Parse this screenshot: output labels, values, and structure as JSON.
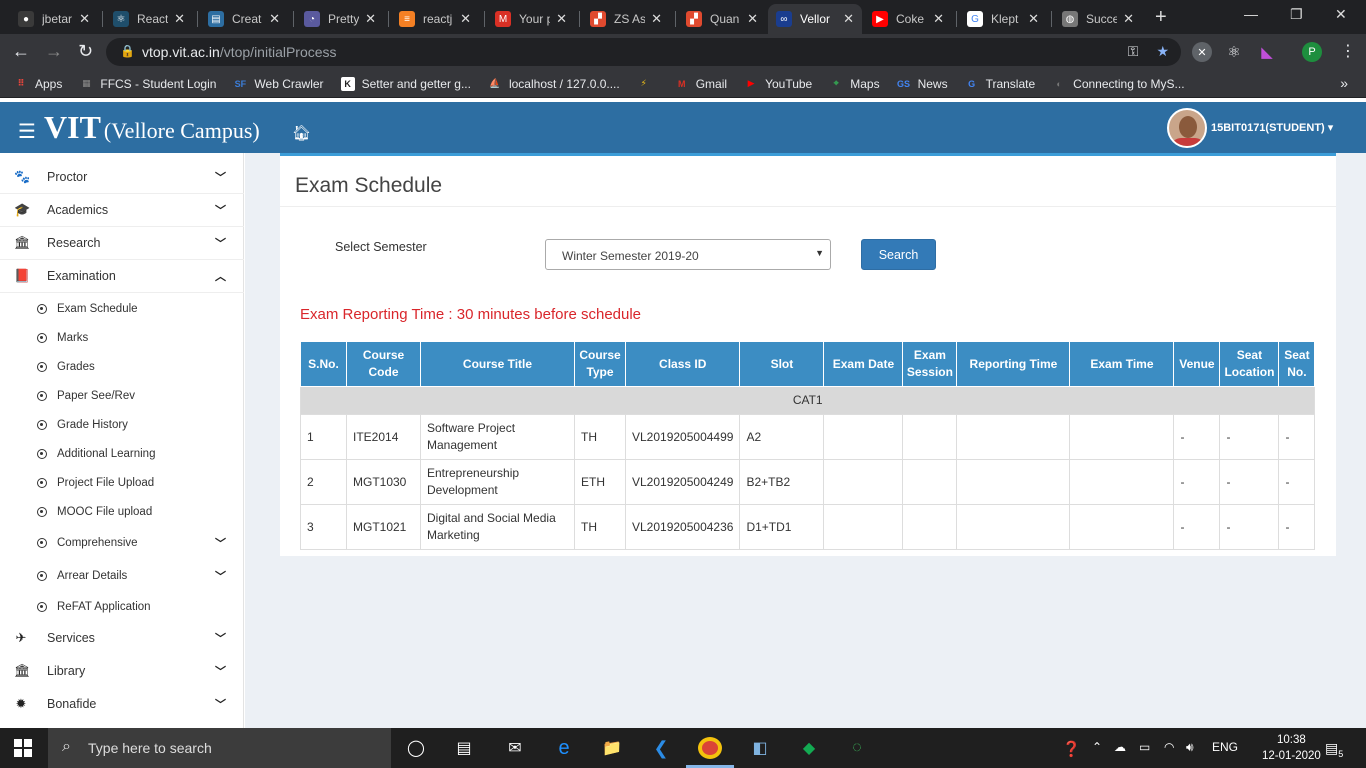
{
  "browser": {
    "tabs": [
      {
        "title": "jbetar",
        "fav_color": "#3a3a3a",
        "fav_glyph": "●"
      },
      {
        "title": "React",
        "fav_color": "#1f4e6b",
        "fav_glyph": "⚛"
      },
      {
        "title": "Creat",
        "fav_color": "#2d6ea2",
        "fav_glyph": "▤"
      },
      {
        "title": "Pretty",
        "fav_color": "#5a5a9e",
        "fav_glyph": "◔"
      },
      {
        "title": "reactj",
        "fav_color": "#f48024",
        "fav_glyph": "≡"
      },
      {
        "title": "Your p",
        "fav_color": "#d93025",
        "fav_glyph": "M"
      },
      {
        "title": "ZS As",
        "fav_color": "#e04a2f",
        "fav_glyph": "▞"
      },
      {
        "title": "Quan",
        "fav_color": "#e04a2f",
        "fav_glyph": "▞"
      },
      {
        "title": "Vellor",
        "fav_color": "#1a3d8f",
        "fav_glyph": "∞"
      },
      {
        "title": "Coke",
        "fav_color": "#ff0000",
        "fav_glyph": "▶"
      },
      {
        "title": "Klept",
        "fav_color": "#ffffff",
        "fav_glyph": "G"
      },
      {
        "title": "Succe",
        "fav_color": "#777777",
        "fav_glyph": "◍"
      }
    ],
    "active_tab_index": 8,
    "url_host": "vtop.vit.ac.in",
    "url_path": "/vtop/initialProcess",
    "profile_initial": "P",
    "bookmarks": [
      {
        "label": "Apps",
        "icon_color": "#e8453c",
        "glyph": "⠿"
      },
      {
        "label": "FFCS - Student Login",
        "icon_color": "#8a8a8a",
        "glyph": "▦"
      },
      {
        "label": "Web Crawler",
        "icon_color": "#3b7dd8",
        "glyph": "SF"
      },
      {
        "label": "Setter and getter g...",
        "icon_color": "#ffffff",
        "glyph": "K"
      },
      {
        "label": "localhost / 127.0.0....",
        "icon_color": "#f0a030",
        "glyph": "⛵"
      },
      {
        "label": "",
        "icon_color": "#f5c518",
        "glyph": "⚡"
      },
      {
        "label": "Gmail",
        "icon_color": "#d93025",
        "glyph": "M"
      },
      {
        "label": "YouTube",
        "icon_color": "#ff0000",
        "glyph": "▶"
      },
      {
        "label": "Maps",
        "icon_color": "#34a853",
        "glyph": "⌖"
      },
      {
        "label": "News",
        "icon_color": "#4285f4",
        "glyph": "GS"
      },
      {
        "label": "Translate",
        "icon_color": "#4285f4",
        "glyph": "G"
      },
      {
        "label": "Connecting to MyS...",
        "icon_color": "#777777",
        "glyph": "◐"
      }
    ]
  },
  "header": {
    "brand": "VIT",
    "campus": "(Vellore Campus)",
    "user_id": "15BIT0171(STUDENT)"
  },
  "sidebar": {
    "items": [
      {
        "label": "Proctor",
        "icon": "paw-icon",
        "glyph": "🐾",
        "expanded": false
      },
      {
        "label": "Academics",
        "icon": "graduation-cap-icon",
        "glyph": "🎓",
        "expanded": false
      },
      {
        "label": "Research",
        "icon": "institution-icon",
        "glyph": "🏛",
        "expanded": false
      },
      {
        "label": "Examination",
        "icon": "book-icon",
        "glyph": "📕",
        "expanded": true
      }
    ],
    "sub_items": [
      {
        "label": "Exam Schedule",
        "has_chevron": false
      },
      {
        "label": "Marks",
        "has_chevron": false
      },
      {
        "label": "Grades",
        "has_chevron": false
      },
      {
        "label": "Paper See/Rev",
        "has_chevron": false
      },
      {
        "label": "Grade History",
        "has_chevron": false
      },
      {
        "label": "Additional Learning",
        "has_chevron": false
      },
      {
        "label": "Project File Upload",
        "has_chevron": false
      },
      {
        "label": "MOOC File upload",
        "has_chevron": false
      },
      {
        "label": "Comprehensive",
        "has_chevron": true
      },
      {
        "label": "Arrear Details",
        "has_chevron": true
      },
      {
        "label": "ReFAT Application",
        "has_chevron": false
      }
    ],
    "bottom_items": [
      {
        "label": "Services",
        "icon": "plane-icon",
        "glyph": "✈"
      },
      {
        "label": "Library",
        "icon": "institution-icon",
        "glyph": "🏛"
      },
      {
        "label": "Bonafide",
        "icon": "gear-icon",
        "glyph": "✹"
      }
    ]
  },
  "main": {
    "title": "Exam Schedule",
    "select_label": "Select Semester",
    "selected_semester": "Winter Semester 2019-20",
    "search_label": "Search",
    "reporting_label": "Exam Reporting Time",
    "reporting_value": ": 30 minutes before schedule",
    "columns": [
      "S.No.",
      "Course Code",
      "Course Title",
      "Course Type",
      "Class ID",
      "Slot",
      "Exam Date",
      "Exam Session",
      "Reporting Time",
      "Exam Time",
      "Venue",
      "Seat Location",
      "Seat No."
    ],
    "group": "CAT1",
    "rows": [
      [
        "1",
        "ITE2014",
        "Software Project Management",
        "TH",
        "VL2019205004499",
        "A2",
        "",
        "",
        "",
        "",
        "-",
        "-",
        "-"
      ],
      [
        "2",
        "MGT1030",
        "Entrepreneurship Development",
        "ETH",
        "VL2019205004249",
        "B2+TB2",
        "",
        "",
        "",
        "",
        "-",
        "-",
        "-"
      ],
      [
        "3",
        "MGT1021",
        "Digital and Social Media Marketing",
        "TH",
        "VL2019205004236",
        "D1+TD1",
        "",
        "",
        "",
        "",
        "-",
        "-",
        "-"
      ]
    ]
  },
  "taskbar": {
    "search_placeholder": "Type here to search",
    "language": "ENG",
    "time": "10:38",
    "date": "12-01-2020",
    "notification_count": "5"
  },
  "colors": {
    "header_blue": "#2d6ea2",
    "table_header": "#3c8dc3",
    "reporting_red": "#d9262b",
    "button_blue": "#337ab7"
  }
}
